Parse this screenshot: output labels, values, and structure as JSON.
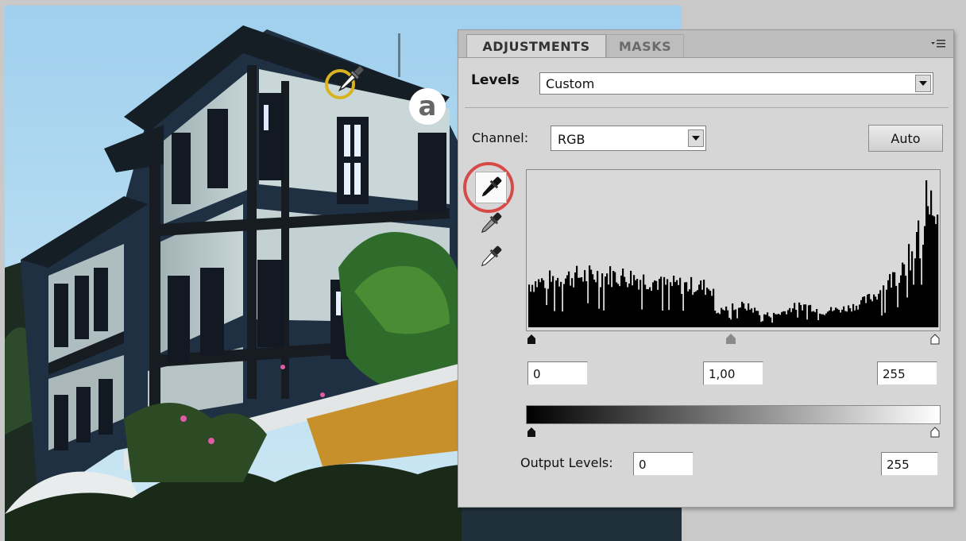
{
  "panel": {
    "tabs": [
      {
        "label": "ADJUSTMENTS",
        "active": true
      },
      {
        "label": "MASKS",
        "active": false
      }
    ],
    "menu_icon": "panel-menu-icon",
    "adjustment_label": "Levels",
    "preset": {
      "value": "Custom"
    },
    "channel": {
      "label": "Channel:",
      "value": "RGB"
    },
    "auto_label": "Auto",
    "input_levels": {
      "black": "0",
      "gamma": "1,00",
      "white": "255"
    },
    "output_levels": {
      "label": "Output Levels:",
      "black": "0",
      "white": "255"
    }
  },
  "annotation": {
    "marker_letter": "a",
    "ring_color_photo": "#d8b21f",
    "ring_color_panel": "#d64a4a"
  },
  "colors": {
    "panel_bg": "#d6d6d6",
    "tab_bar": "#bdbdbd",
    "histogram_bg": "#d9d9d9"
  }
}
